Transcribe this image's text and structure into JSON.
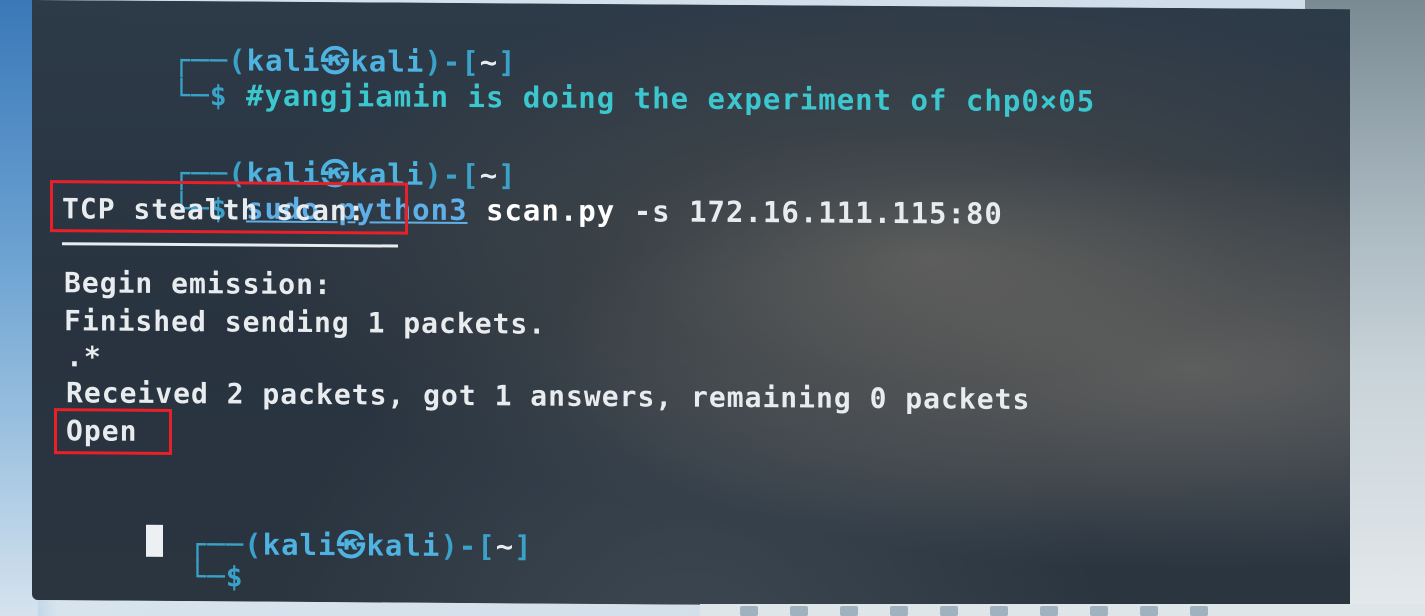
{
  "terminal": {
    "prompt": {
      "open_bracket": "┌──(",
      "user": "kali",
      "at_symbol": "㉿",
      "host": "kali",
      "close_bracket": ")-[",
      "cwd": "~",
      "end_bracket": "]",
      "dollar": "$"
    },
    "block1": {
      "command": "#yangjiamin is doing the experiment of chp0×05"
    },
    "block2": {
      "command_sudo": "sudo python3",
      "command_file": "scan.py",
      "command_args": "-s 172.16.111.115:80",
      "output_title": "TCP stealth scan:",
      "output_lines": [
        "Begin emission:",
        "Finished sending 1 packets.",
        ".*",
        "Received 2 packets, got 1 answers, remaining 0 packets"
      ],
      "result": "Open"
    },
    "block3": {
      "command": ""
    }
  },
  "colors": {
    "terminal_bg": "#27323f",
    "prompt_cyan": "#3aa2c9",
    "highlight_red": "#e8202a",
    "output_text": "#e9ecef"
  }
}
